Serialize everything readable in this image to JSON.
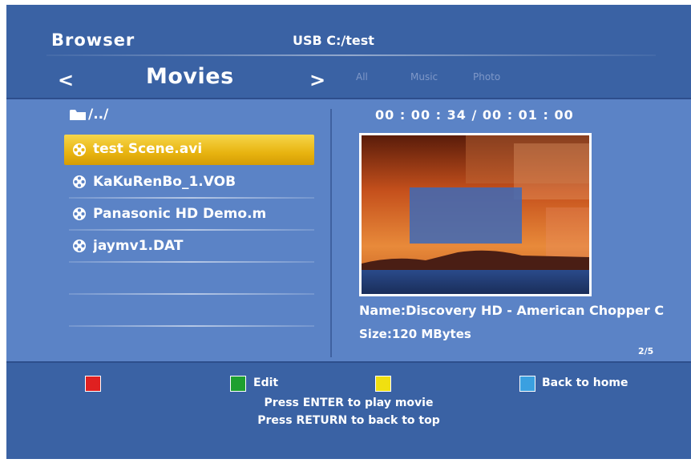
{
  "header": {
    "title": "Browser",
    "source": "USB  C:/test",
    "prev_arrow": "<",
    "category": "Movies",
    "next_arrow": ">",
    "filters": [
      "All",
      "Music",
      "Photo"
    ]
  },
  "file_list": {
    "up_label": "/../",
    "items": [
      {
        "label": "test Scene.avi",
        "selected": true
      },
      {
        "label": "KaKuRenBo_1.VOB",
        "selected": false
      },
      {
        "label": "Panasonic HD Demo.m",
        "selected": false
      },
      {
        "label": "jaymv1.DAT",
        "selected": false
      }
    ]
  },
  "preview": {
    "time": "00 : 00 : 34  / 00 : 01 : 00",
    "name": "Name:Discovery HD - American Chopper C",
    "size": "Size:120 MBytes",
    "page": "2/5"
  },
  "footer": {
    "red_label": "",
    "green_label": "Edit",
    "yellow_label": "",
    "blue_label": "Back to home",
    "hint1": "Press ENTER to play movie",
    "hint2": "Press RETURN to back to top"
  },
  "colors": {
    "background": "#3a62a4",
    "panel": "#5b83c6",
    "highlight": "#e8b410",
    "key_red": "#e02020",
    "key_green": "#1ea030",
    "key_yellow": "#f0e010",
    "key_blue": "#3aa0e0"
  },
  "icons": {
    "folder": "folder-icon",
    "file": "film-reel-icon"
  }
}
